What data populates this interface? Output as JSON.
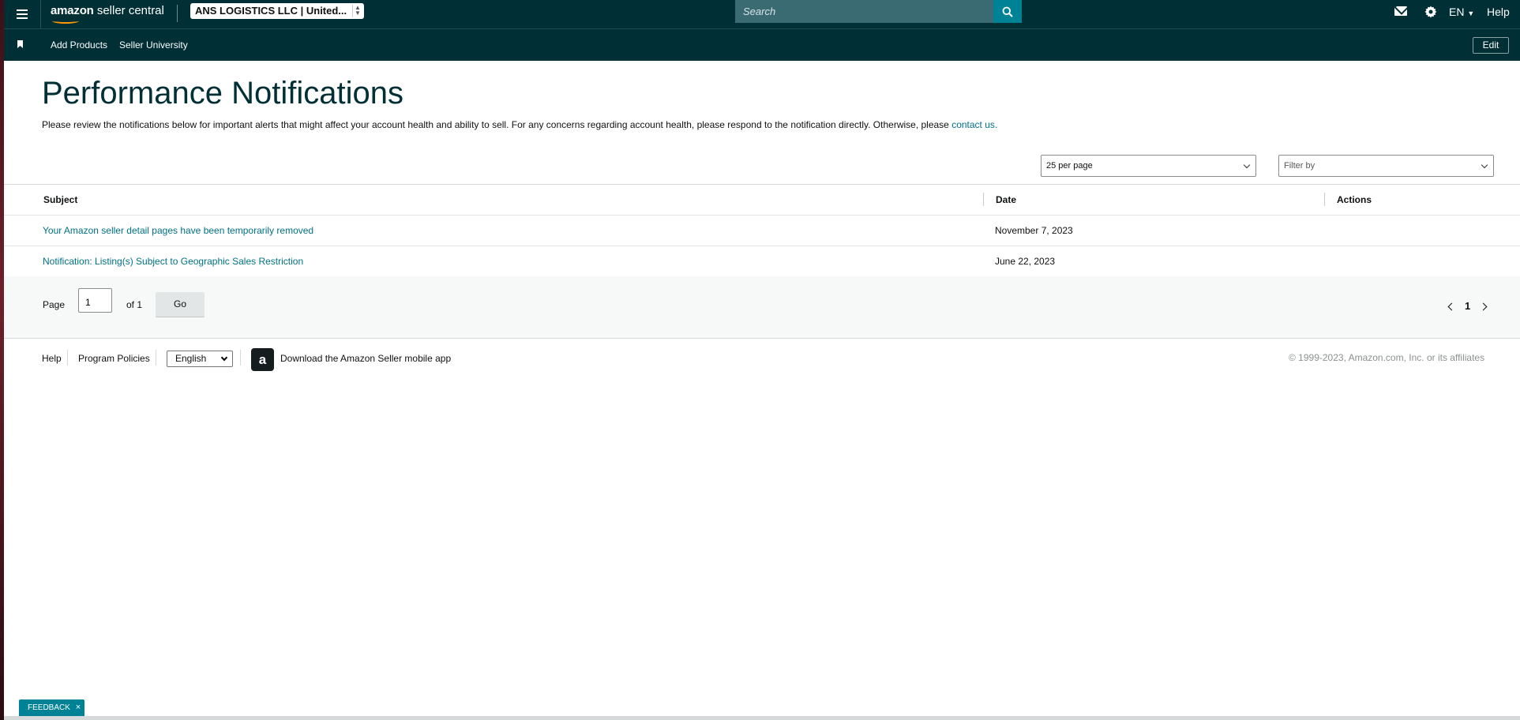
{
  "topbar": {
    "logo_bold": "amazon",
    "logo_rest": " seller central",
    "account": "ANS LOGISTICS LLC | United...",
    "search_placeholder": "Search",
    "language": "EN",
    "help": "Help"
  },
  "navbar": {
    "links": [
      "Add Products",
      "Seller University"
    ],
    "edit": "Edit"
  },
  "page": {
    "title": "Performance Notifications",
    "description": "Please review the notifications below for important alerts that might affect your account health and ability to sell. For any concerns regarding account health, please respond to the notification directly. Otherwise, please ",
    "contact_link": "contact us."
  },
  "filters": {
    "per_page": "25 per page",
    "filter_by": "Filter by"
  },
  "table": {
    "headers": [
      "Subject",
      "Date",
      "Actions"
    ],
    "rows": [
      {
        "subject": "Your Amazon seller detail pages have been temporarily removed",
        "date": "November 7, 2023"
      },
      {
        "subject": "Notification: Listing(s) Subject to Geographic Sales Restriction",
        "date": "June 22, 2023"
      }
    ]
  },
  "pager": {
    "page_label": "Page",
    "page_value": "1",
    "of_label": "of 1",
    "go": "Go",
    "current": "1"
  },
  "footer": {
    "help": "Help",
    "policies": "Program Policies",
    "language": "English",
    "app_letter": "a",
    "app_text": "Download the Amazon Seller mobile app",
    "copyright": "© 1999-2023, Amazon.com, Inc. or its affiliates"
  },
  "feedback": {
    "label": "FEEDBACK",
    "close": "×"
  },
  "colors": {
    "header_bg": "#002f36",
    "link": "#007185",
    "search_button": "#008296"
  }
}
